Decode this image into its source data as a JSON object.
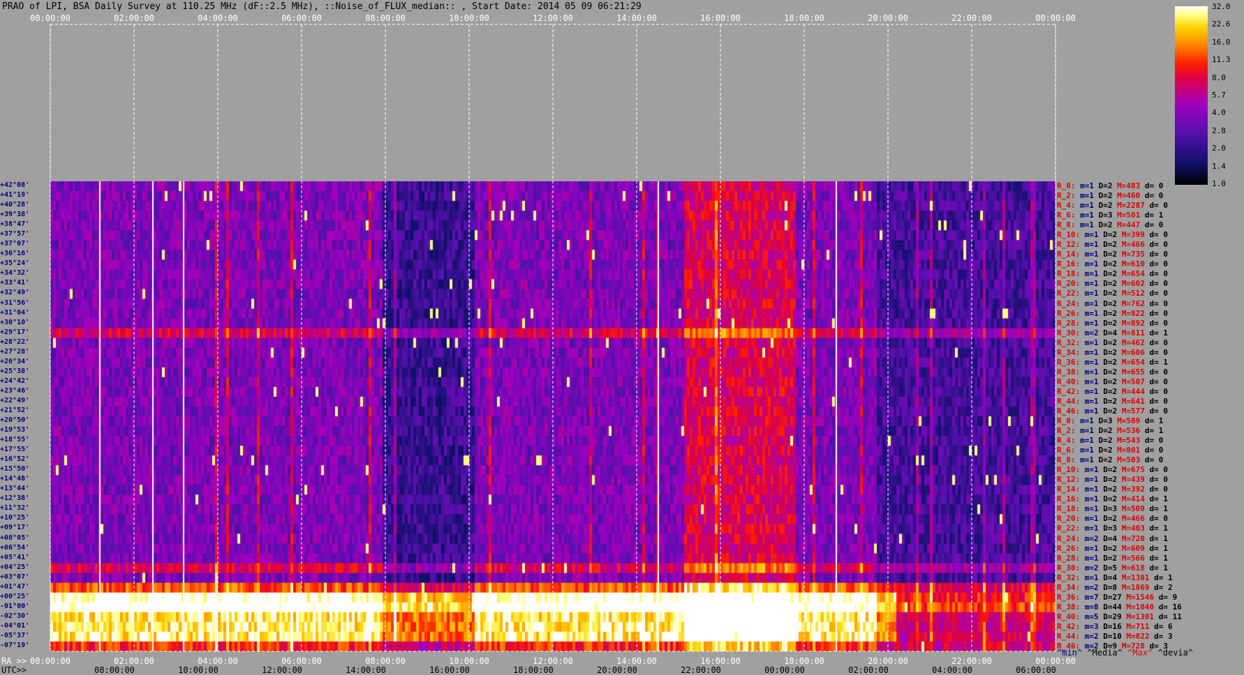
{
  "title": "PRAO of LPI, BSA Daily Survey at 110.25 MHz (dF::2.5 MHz), ::Noise_of_FLUX_median:: , Start Date: 2014 05 09 06:21:29",
  "chart_data": {
    "type": "heatmap",
    "title": "PRAO of LPI, BSA Daily Survey at 110.25 MHz (dF::2.5 MHz), ::Noise_of_FLUX_median:: , Start Date: 2014 05 09 06:21:29",
    "x_top_ticks": [
      "00:00:00",
      "02:00:00",
      "04:00:00",
      "06:00:00",
      "08:00:00",
      "10:00:00",
      "12:00:00",
      "14:00:00",
      "16:00:00",
      "18:00:00",
      "20:00:00",
      "22:00:00",
      "00:00:00"
    ],
    "ra_ticks": [
      "00:00:00",
      "02:00:00",
      "04:00:00",
      "06:00:00",
      "08:00:00",
      "10:00:00",
      "12:00:00",
      "14:00:00",
      "16:00:00",
      "18:00:00",
      "20:00:00",
      "22:00:00",
      "00:00:00"
    ],
    "utc_ticks": [
      "08:00:00",
      "10:00:00",
      "12:00:00",
      "14:00:00",
      "16:00:00",
      "18:00:00",
      "20:00:00",
      "22:00:00",
      "00:00:00",
      "02:00:00",
      "04:00:00",
      "06:00:00"
    ],
    "ra_label": "RA >>",
    "utc_label": "UTC>>",
    "colorbar_ticks": [
      "32.0",
      "22.6",
      "16.0",
      "11.3",
      "8.0",
      "5.7",
      "4.0",
      "2.8",
      "2.0",
      "1.4",
      "1.0"
    ],
    "declinations": [
      "+42°08'",
      "+41°19'",
      "+40°28'",
      "+39°38'",
      "+38°47'",
      "+37°57'",
      "+37°07'",
      "+36°16'",
      "+35°24'",
      "+34°32'",
      "+33°41'",
      "+32°49'",
      "+31°56'",
      "+31°04'",
      "+30°10'",
      "+29°17'",
      "+28°22'",
      "+27°28'",
      "+26°34'",
      "+25°38'",
      "+24°42'",
      "+23°46'",
      "+22°49'",
      "+21°52'",
      "+20°50'",
      "+19°53'",
      "+18°55'",
      "+17°55'",
      "+16°52'",
      "+15°50'",
      "+14°48'",
      "+13°44'",
      "+12°38'",
      "+11°32'",
      "+10°25'",
      "+09°17'",
      "+08°05'",
      "+06°54'",
      "+05°41'",
      "+04°25'",
      "+03°07'",
      "+01°47'",
      "+00°25'",
      "-01°00'",
      "-02°30'",
      "-04°01'",
      "-05°37'",
      "-07°19'"
    ],
    "stats": [
      {
        "r": "R_0:",
        "m": "m=1",
        "D": "D=2",
        "M": "M=483",
        "d": "d= 0"
      },
      {
        "r": "R_2:",
        "m": "m=1",
        "D": "D=2",
        "M": "M=460",
        "d": "d= 0"
      },
      {
        "r": "R_4:",
        "m": "m=1",
        "D": "D=2",
        "M": "M=2287",
        "d": "d= 0"
      },
      {
        "r": "R_6:",
        "m": "m=1",
        "D": "D=3",
        "M": "M=501",
        "d": "d= 1"
      },
      {
        "r": "R_8:",
        "m": "m=1",
        "D": "D=2",
        "M": "M=447",
        "d": "d= 0"
      },
      {
        "r": "R_10:",
        "m": "m=1",
        "D": "D=2",
        "M": "M=399",
        "d": "d= 0"
      },
      {
        "r": "R_12:",
        "m": "m=1",
        "D": "D=2",
        "M": "M=466",
        "d": "d= 0"
      },
      {
        "r": "R_14:",
        "m": "m=1",
        "D": "D=2",
        "M": "M=735",
        "d": "d= 0"
      },
      {
        "r": "R_16:",
        "m": "m=1",
        "D": "D=2",
        "M": "M=610",
        "d": "d= 0"
      },
      {
        "r": "R_18:",
        "m": "m=1",
        "D": "D=2",
        "M": "M=654",
        "d": "d= 0"
      },
      {
        "r": "R_20:",
        "m": "m=1",
        "D": "D=2",
        "M": "M=602",
        "d": "d= 0"
      },
      {
        "r": "R_22:",
        "m": "m=1",
        "D": "D=2",
        "M": "M=512",
        "d": "d= 0"
      },
      {
        "r": "R_24:",
        "m": "m=1",
        "D": "D=2",
        "M": "M=762",
        "d": "d= 0"
      },
      {
        "r": "R_26:",
        "m": "m=1",
        "D": "D=2",
        "M": "M=822",
        "d": "d= 0"
      },
      {
        "r": "R_28:",
        "m": "m=1",
        "D": "D=2",
        "M": "M=892",
        "d": "d= 0"
      },
      {
        "r": "R_30:",
        "m": "m=2",
        "D": "D=4",
        "M": "M=811",
        "d": "d= 1"
      },
      {
        "r": "R_32:",
        "m": "m=1",
        "D": "D=2",
        "M": "M=462",
        "d": "d= 0"
      },
      {
        "r": "R_34:",
        "m": "m=1",
        "D": "D=2",
        "M": "M=606",
        "d": "d= 0"
      },
      {
        "r": "R_36:",
        "m": "m=1",
        "D": "D=2",
        "M": "M=654",
        "d": "d= 1"
      },
      {
        "r": "R_38:",
        "m": "m=1",
        "D": "D=2",
        "M": "M=655",
        "d": "d= 0"
      },
      {
        "r": "R_40:",
        "m": "m=1",
        "D": "D=2",
        "M": "M=507",
        "d": "d= 0"
      },
      {
        "r": "R_42:",
        "m": "m=1",
        "D": "D=2",
        "M": "M=444",
        "d": "d= 0"
      },
      {
        "r": "R_44:",
        "m": "m=1",
        "D": "D=2",
        "M": "M=641",
        "d": "d= 0"
      },
      {
        "r": "R_46:",
        "m": "m=1",
        "D": "D=2",
        "M": "M=577",
        "d": "d= 0"
      },
      {
        "r": "R_0:",
        "m": "m=1",
        "D": "D=3",
        "M": "M=589",
        "d": "d= 1"
      },
      {
        "r": "R_2:",
        "m": "m=1",
        "D": "D=2",
        "M": "M=536",
        "d": "d= 1"
      },
      {
        "r": "R_4:",
        "m": "m=1",
        "D": "D=2",
        "M": "M=543",
        "d": "d= 0"
      },
      {
        "r": "R_6:",
        "m": "m=1",
        "D": "D=2",
        "M": "M=801",
        "d": "d= 0"
      },
      {
        "r": "R_8:",
        "m": "m=1",
        "D": "D=2",
        "M": "M=503",
        "d": "d= 0"
      },
      {
        "r": "R_10:",
        "m": "m=1",
        "D": "D=2",
        "M": "M=675",
        "d": "d= 0"
      },
      {
        "r": "R_12:",
        "m": "m=1",
        "D": "D=2",
        "M": "M=439",
        "d": "d= 0"
      },
      {
        "r": "R_14:",
        "m": "m=1",
        "D": "D=2",
        "M": "M=392",
        "d": "d= 0"
      },
      {
        "r": "R_16:",
        "m": "m=1",
        "D": "D=2",
        "M": "M=414",
        "d": "d= 1"
      },
      {
        "r": "R_18:",
        "m": "m=1",
        "D": "D=3",
        "M": "M=509",
        "d": "d= 1"
      },
      {
        "r": "R_20:",
        "m": "m=1",
        "D": "D=2",
        "M": "M=466",
        "d": "d= 0"
      },
      {
        "r": "R_22:",
        "m": "m=1",
        "D": "D=3",
        "M": "M=403",
        "d": "d= 1"
      },
      {
        "r": "R_24:",
        "m": "m=2",
        "D": "D=4",
        "M": "M=720",
        "d": "d= 1"
      },
      {
        "r": "R_26:",
        "m": "m=1",
        "D": "D=2",
        "M": "M=609",
        "d": "d= 1"
      },
      {
        "r": "R_28:",
        "m": "m=1",
        "D": "D=2",
        "M": "M=566",
        "d": "d= 1"
      },
      {
        "r": "R_30:",
        "m": "m=2",
        "D": "D=5",
        "M": "M=618",
        "d": "d= 1"
      },
      {
        "r": "R_32:",
        "m": "m=1",
        "D": "D=4",
        "M": "M=1301",
        "d": "d= 1"
      },
      {
        "r": "R_34:",
        "m": "m=2",
        "D": "D=8",
        "M": "M=1869",
        "d": "d= 2"
      },
      {
        "r": "R_36:",
        "m": "m=7",
        "D": "D=27",
        "M": "M=1546",
        "d": "d= 9"
      },
      {
        "r": "R_38:",
        "m": "m=8",
        "D": "D=44",
        "M": "M=1040",
        "d": "d= 16"
      },
      {
        "r": "R_40:",
        "m": "m=5",
        "D": "D=29",
        "M": "M=1301",
        "d": "d= 11"
      },
      {
        "r": "R_42:",
        "m": "m=3",
        "D": "D=16",
        "M": "M=711",
        "d": "d= 6"
      },
      {
        "r": "R_44:",
        "m": "m=2",
        "D": "D=10",
        "M": "M=822",
        "d": "d= 3"
      },
      {
        "r": "R_46:",
        "m": "m=2",
        "D": "D=9",
        "M": "M=728",
        "d": "d= 3"
      }
    ],
    "legend": {
      "min": "^min^",
      "media": "^Media^",
      "max": "^Max^",
      "devia": "^devia^"
    }
  }
}
